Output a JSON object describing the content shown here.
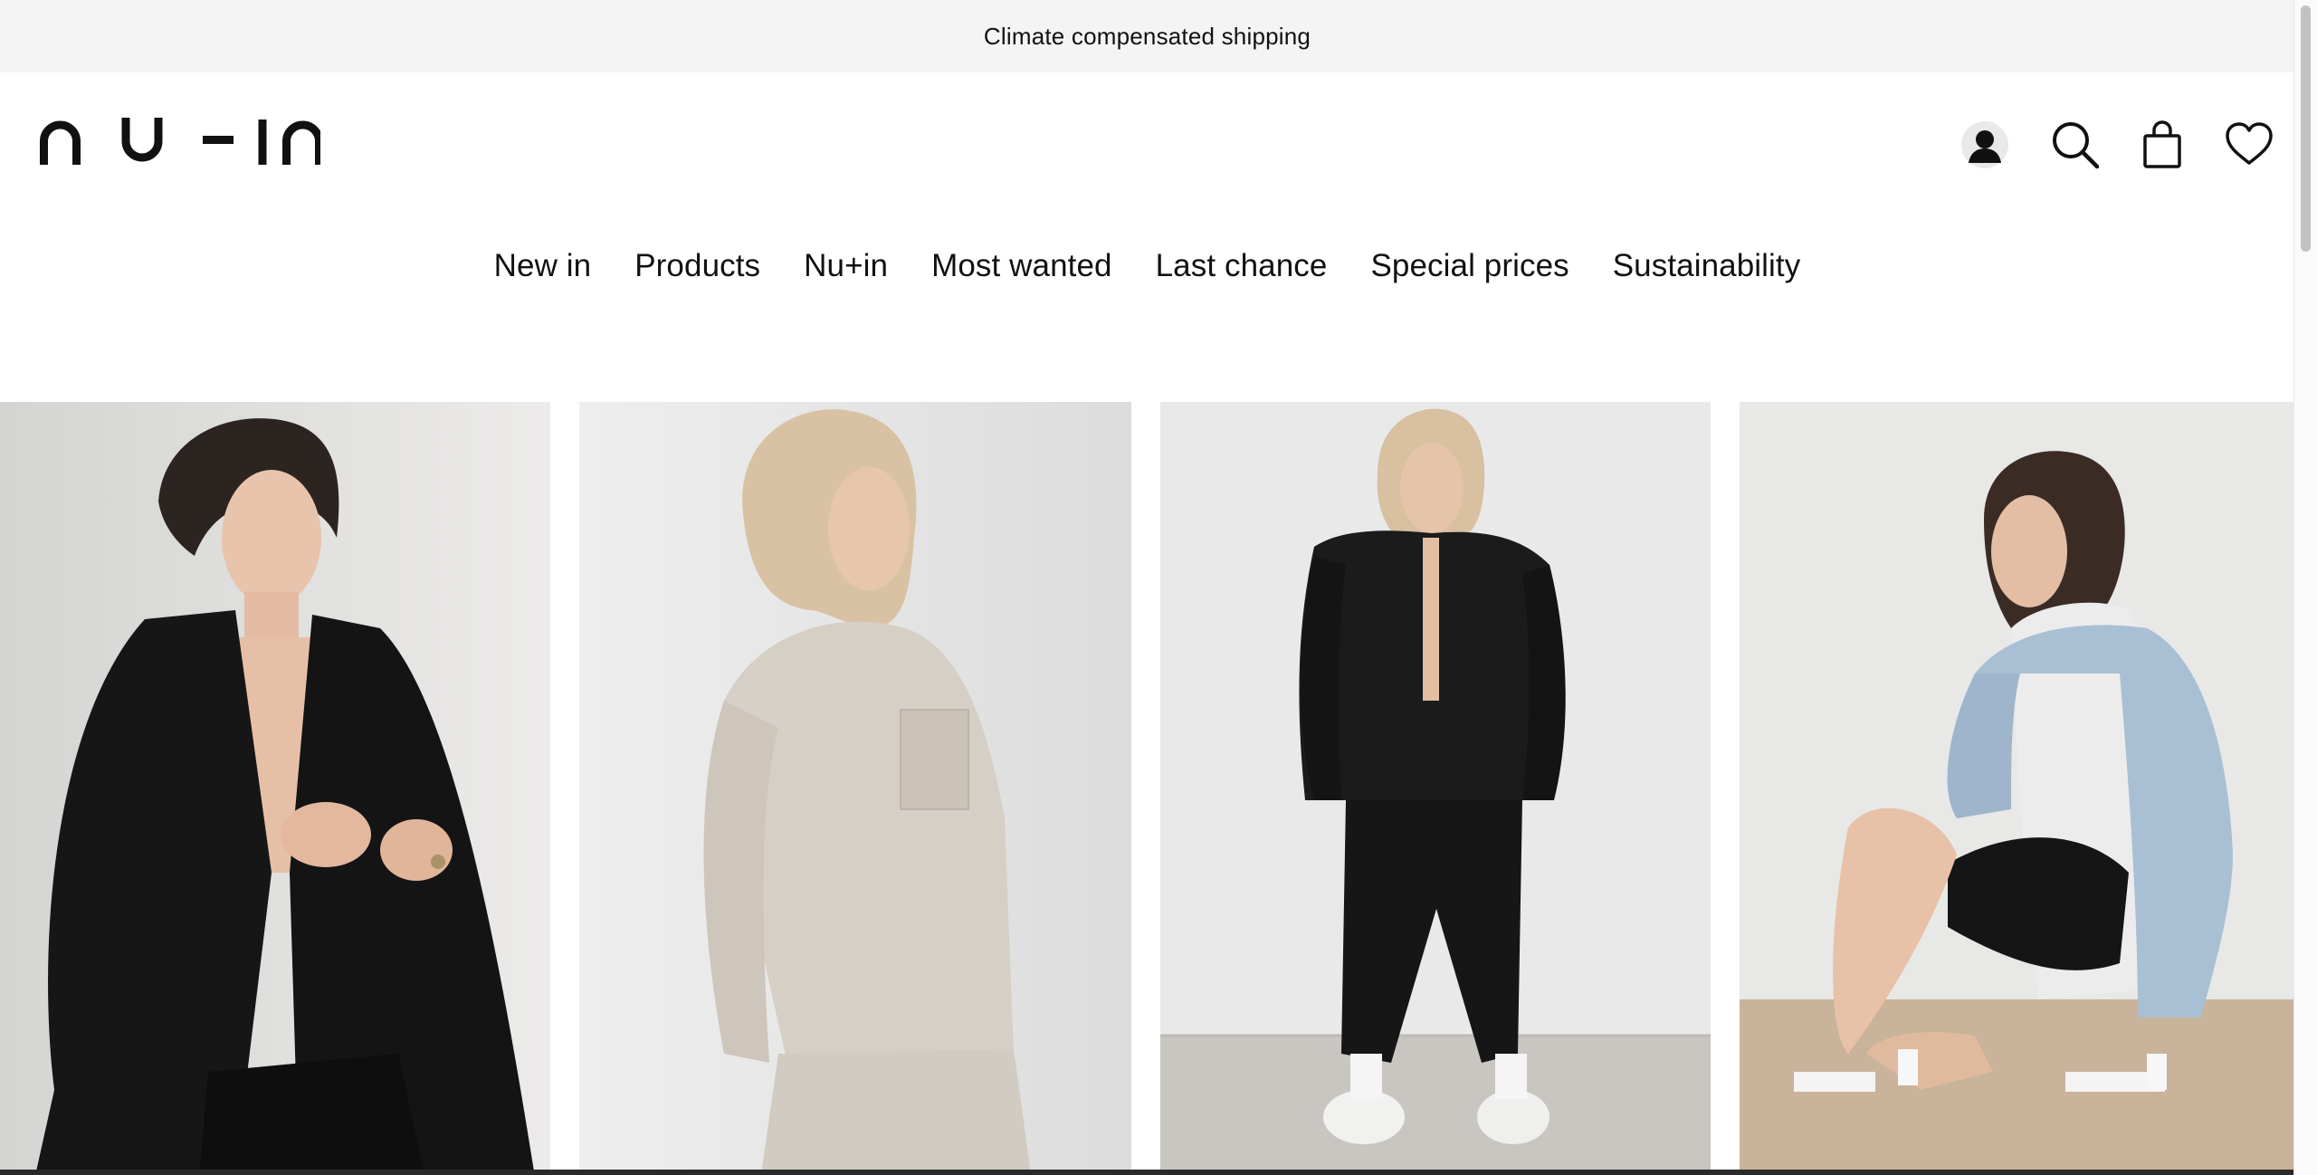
{
  "announcement": {
    "text": "Climate compensated shipping"
  },
  "header": {
    "logo_text": "nu-in",
    "icons": {
      "account": "account-icon",
      "search": "search-icon",
      "bag": "shopping-bag-icon",
      "wishlist": "heart-icon"
    }
  },
  "nav": {
    "items": [
      {
        "label": "New in"
      },
      {
        "label": "Products"
      },
      {
        "label": "Nu+in"
      },
      {
        "label": "Most wanted"
      },
      {
        "label": "Last chance"
      },
      {
        "label": "Special prices"
      },
      {
        "label": "Sustainability"
      }
    ]
  },
  "products": [
    {
      "image": "model-black-blazer"
    },
    {
      "image": "model-beige-overshirt"
    },
    {
      "image": "model-black-jacket-joggers"
    },
    {
      "image": "model-denim-jacket-hoodie"
    }
  ],
  "colors": {
    "announcement_bg": "#f4f4f4",
    "text": "#111111",
    "background": "#ffffff"
  }
}
